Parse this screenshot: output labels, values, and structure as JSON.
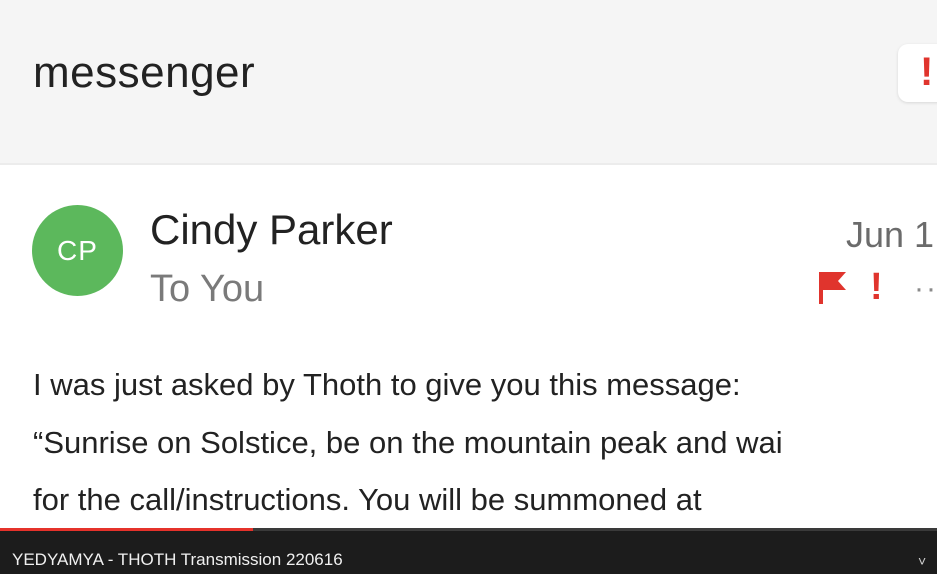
{
  "header": {
    "title": "messenger",
    "action_icon": "!"
  },
  "message": {
    "avatar_initials": "CP",
    "sender": "Cindy Parker",
    "recipient": "To You",
    "date": "Jun 1",
    "important_icon": "!",
    "more_icon": "··",
    "body_lines": [
      "I was just asked by Thoth to give you this message:",
      "“Sunrise on Solstice, be on the mountain peak and wai",
      "for the call/instructions.  You will be summoned at"
    ]
  },
  "video": {
    "title": "YEDYAMYA - THOTH Transmission 220616",
    "progress": 0.27,
    "chevron": "˅"
  },
  "colors": {
    "avatar": "#5cb85c",
    "alert_red": "#e0342d",
    "progress_red": "#e5322b"
  }
}
